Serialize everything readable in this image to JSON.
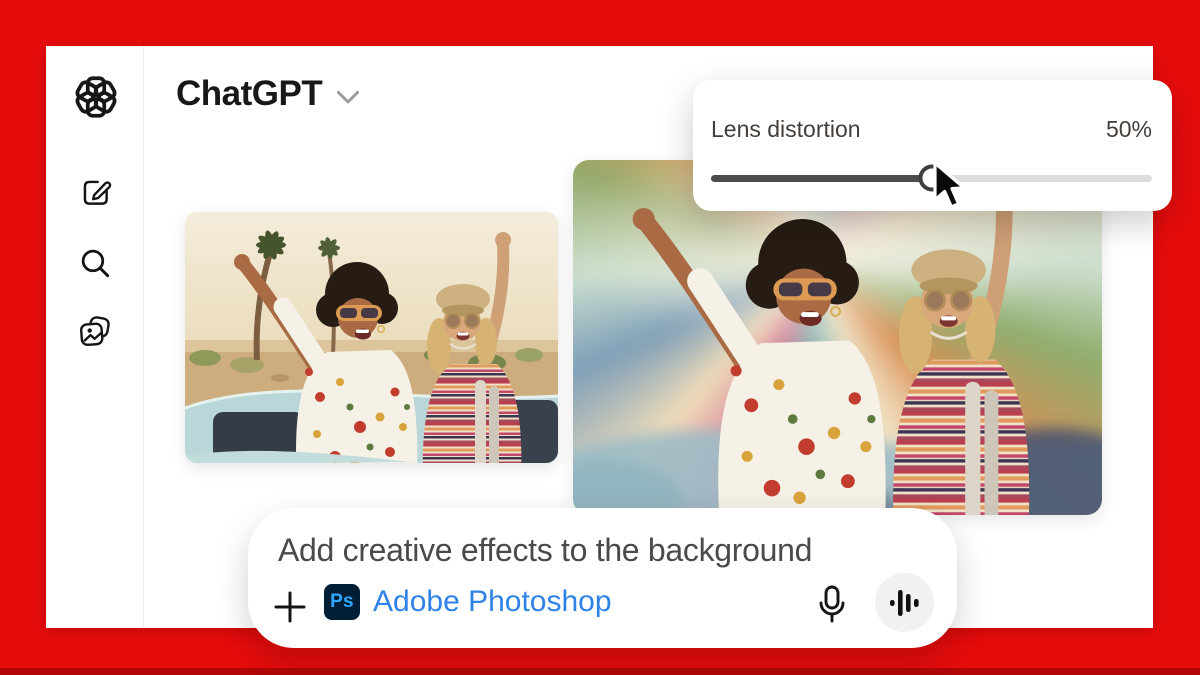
{
  "frame": {
    "border_color": "#e60c0c",
    "bottom_strip_color": "#b20808"
  },
  "header": {
    "title": "ChatGPT"
  },
  "sidebar": {
    "icons": [
      {
        "name": "openai-logo"
      },
      {
        "name": "new-chat-icon"
      },
      {
        "name": "search-icon"
      },
      {
        "name": "library-icon"
      }
    ]
  },
  "lens_panel": {
    "label": "Lens distortion",
    "value_label": "50%",
    "percent": 50
  },
  "composer": {
    "prompt_text": "Add creative effects to the background",
    "app_badge_text": "Ps",
    "app_name": "Adobe Photoshop",
    "colors": {
      "badge_bg": "#001e36",
      "badge_text": "#31a8ff",
      "app_name_text": "#2e82e8"
    }
  },
  "images": [
    {
      "name": "original-photo"
    },
    {
      "name": "edited-photo-lens-distortion"
    }
  ]
}
